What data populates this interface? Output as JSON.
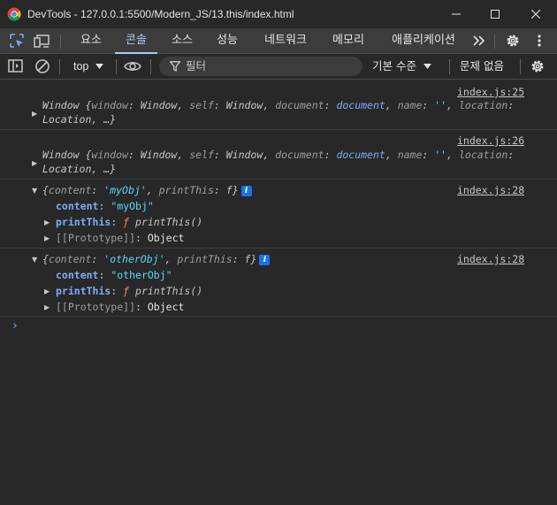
{
  "window": {
    "title": "DevTools - 127.0.0.1:5500/Modern_JS/13.this/index.html",
    "app_icon": "chrome-icon"
  },
  "tabs": [
    {
      "label": "요소"
    },
    {
      "label": "콘솔",
      "active": true
    },
    {
      "label": "소스"
    },
    {
      "label": "성능"
    },
    {
      "label": "네트워크"
    },
    {
      "label": "메모리"
    },
    {
      "label": "애플리케이션"
    }
  ],
  "toolbar": {
    "context": "top",
    "filter_placeholder": "필터",
    "levels": "기본 수준",
    "issues": "문제 없음"
  },
  "messages": [
    {
      "source": "index.js:25",
      "line1": [
        "Window ",
        "{",
        "window",
        ": ",
        "Window",
        ", ",
        "self",
        ": ",
        "Window",
        ", ",
        "document",
        ": ",
        "document",
        ", ",
        "name",
        ": ",
        "''",
        ", ",
        "location",
        ":"
      ],
      "line2": "Location, …}"
    },
    {
      "source": "index.js:26",
      "line1": [
        "Window ",
        "{",
        "window",
        ": ",
        "Window",
        ", ",
        "self",
        ": ",
        "Window",
        ", ",
        "document",
        ": ",
        "document",
        ", ",
        "name",
        ": ",
        "''",
        ", ",
        "location",
        ":"
      ],
      "line2": "Location, …}"
    },
    {
      "source": "index.js:28",
      "preview": {
        "open": "{",
        "k1": "content",
        "sep1": ": ",
        "v1": "'myObj'",
        "comma": ", ",
        "k2": "printThis",
        "sep2": ": ",
        "v2": "f",
        "close": "}"
      },
      "props": {
        "content_key": "content",
        "content_sep": ": ",
        "content_val": "\"myObj\"",
        "fn_key": "printThis",
        "fn_sep": ": ",
        "fn_mark": "ƒ",
        "fn_name": " printThis()",
        "proto_key": "[[Prototype]]",
        "proto_sep": ": ",
        "proto_val": "Object"
      }
    },
    {
      "source": "index.js:28",
      "preview": {
        "open": "{",
        "k1": "content",
        "sep1": ": ",
        "v1": "'otherObj'",
        "comma": ", ",
        "k2": "printThis",
        "sep2": ": ",
        "v2": "f",
        "close": "}"
      },
      "props": {
        "content_key": "content",
        "content_sep": ": ",
        "content_val": "\"otherObj\"",
        "fn_key": "printThis",
        "fn_sep": ": ",
        "fn_mark": "ƒ",
        "fn_name": " printThis()",
        "proto_key": "[[Prototype]]",
        "proto_sep": ": ",
        "proto_val": "Object"
      }
    }
  ],
  "prompt": "›"
}
